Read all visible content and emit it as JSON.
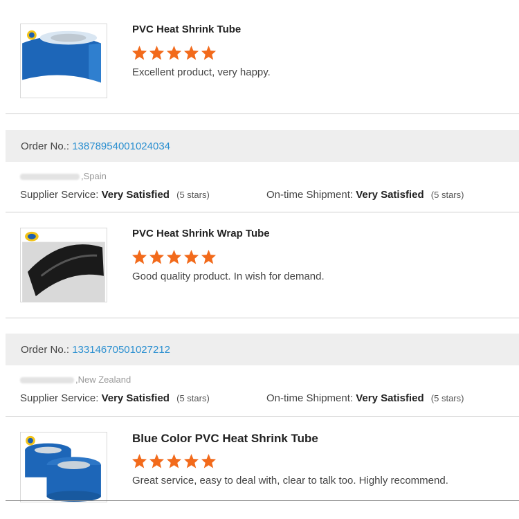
{
  "reviews": [
    {
      "title": "PVC Heat Shrink Tube",
      "rating": 5,
      "comment": "Excellent product, very happy.",
      "image_icon": "blue-tube-roll-icon"
    },
    {
      "title": "PVC Heat Shrink Wrap Tube",
      "rating": 5,
      "comment": "Good quality product. In wish for demand.",
      "image_icon": "black-tube-roll-icon"
    },
    {
      "title": "Blue Color PVC Heat Shrink Tube",
      "rating": 5,
      "comment": "Great service, easy to deal with, clear to talk too. Highly recommend.",
      "image_icon": "blue-tube-rolls-icon"
    }
  ],
  "orders": [
    {
      "order_label": "Order No.:",
      "order_number": "13878954001024034",
      "buyer_country": ",Spain",
      "supplier_label": "Supplier Service:",
      "supplier_value": "Very Satisfied",
      "supplier_stars": "(5 stars)",
      "shipment_label": "On-time Shipment:",
      "shipment_value": "Very Satisfied",
      "shipment_stars": "(5 stars)"
    },
    {
      "order_label": "Order No.:",
      "order_number": "13314670501027212",
      "buyer_country": ",New Zealand",
      "supplier_label": "Supplier Service:",
      "supplier_value": "Very Satisfied",
      "supplier_stars": "(5 stars)",
      "shipment_label": "On-time Shipment:",
      "shipment_value": "Very Satisfied",
      "shipment_stars": "(5 stars)"
    }
  ],
  "colors": {
    "star": "#f26a1b",
    "link": "#2a8fd0",
    "order_bar": "#eeeeee"
  }
}
